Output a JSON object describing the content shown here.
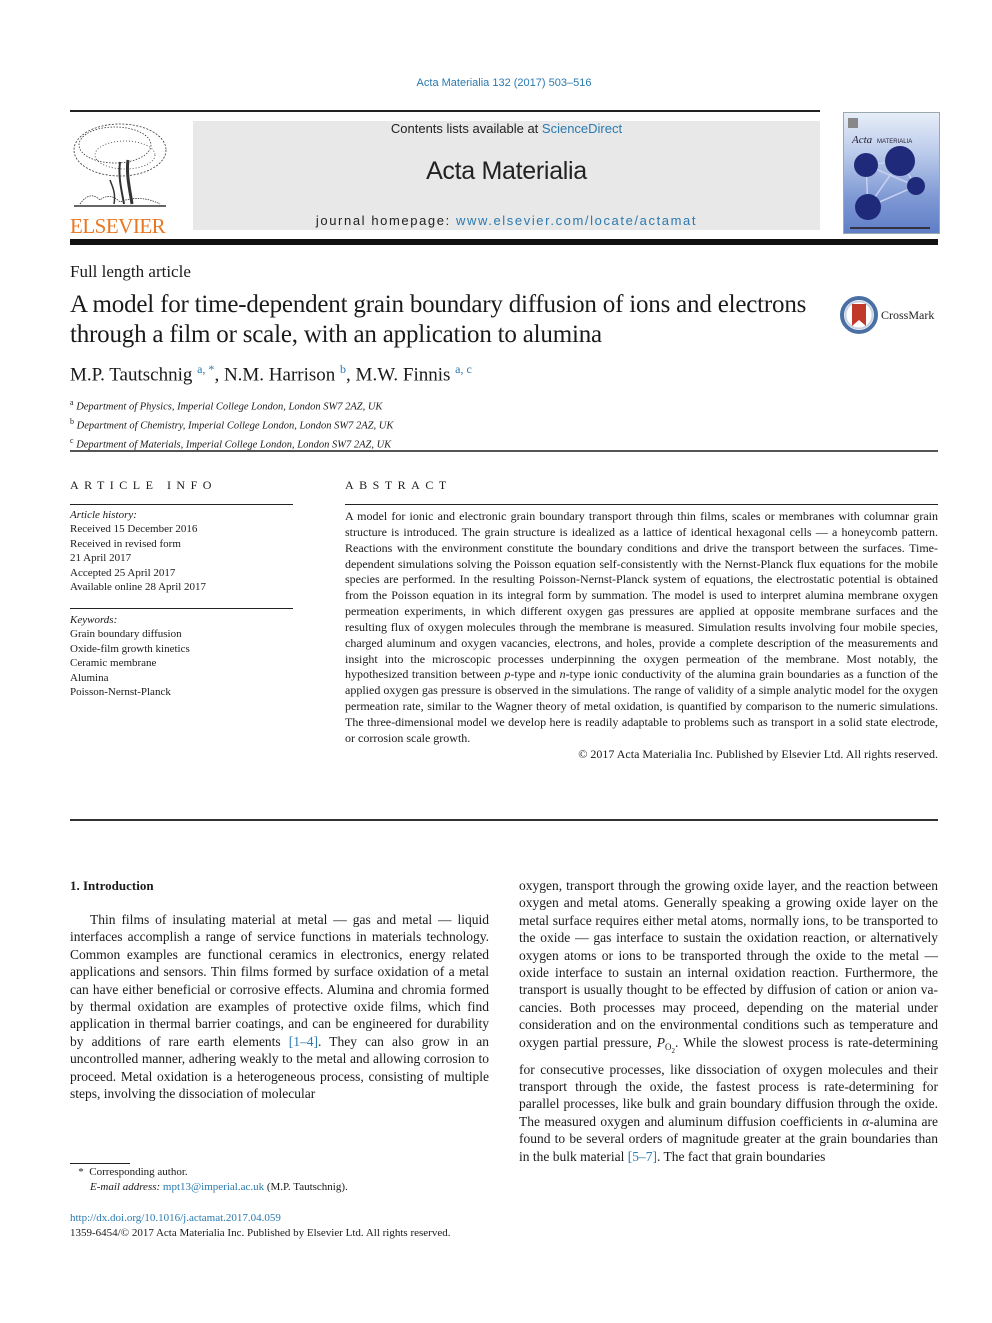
{
  "journal_ref": "Acta Materialia 132 (2017) 503–516",
  "masthead": {
    "contents_prefix": "Contents lists available at ",
    "contents_link": "ScienceDirect",
    "journal_title": "Acta Materialia",
    "homepage_prefix": "journal homepage: ",
    "homepage_link": "www.elsevier.com/locate/actamat"
  },
  "publisher_logo": "ELSEVIER",
  "cover": {
    "title_script": "Acta",
    "title_caps": "MATERIALIA"
  },
  "crossmark_label": "CrossMark",
  "article_type": "Full length article",
  "title": "A model for time-dependent grain boundary diffusion of ions and electrons through a film or scale, with an application to alumina",
  "authors": [
    {
      "name": "M.P. Tautschnig",
      "marks": "a, *"
    },
    {
      "name": "N.M. Harrison",
      "marks": "b"
    },
    {
      "name": "M.W. Finnis",
      "marks": "a, c"
    }
  ],
  "affiliations": [
    {
      "mark": "a",
      "text": "Department of Physics, Imperial College London, London SW7 2AZ, UK"
    },
    {
      "mark": "b",
      "text": "Department of Chemistry, Imperial College London, London SW7 2AZ, UK"
    },
    {
      "mark": "c",
      "text": "Department of Materials, Imperial College London, London SW7 2AZ, UK"
    }
  ],
  "article_info": {
    "heading": "ARTICLE INFO",
    "history_label": "Article history:",
    "history": [
      "Received 15 December 2016",
      "Received in revised form",
      "21 April 2017",
      "Accepted 25 April 2017",
      "Available online 28 April 2017"
    ],
    "keywords_label": "Keywords:",
    "keywords": [
      "Grain boundary diffusion",
      "Oxide-film growth kinetics",
      "Ceramic membrane",
      "Alumina",
      "Poisson-Nernst-Planck"
    ]
  },
  "abstract": {
    "heading": "ABSTRACT",
    "text_1": "A model for ionic and electronic grain boundary transport through thin films, scales or membranes with columnar grain structure is introduced. The grain structure is idealized as a lattice of identical hexagonal cells — a honeycomb pattern. Reactions with the environment constitute the boundary conditions and drive the transport between the surfaces. Time-dependent simulations solving the Poisson equation self-consistently with the Nernst-Planck flux equations for the mobile species are performed. In the resulting Poisson-Nernst-Planck system of equations, the electrostatic potential is obtained from the Poisson equation in its integral form by summation. The model is used to interpret alumina membrane oxygen permeation experiments, in which different oxygen gas pressures are applied at opposite membrane surfaces and the resulting flux of oxygen molecules through the membrane is measured. Simulation results involving four mobile species, charged aluminum and oxygen vacancies, electrons, and holes, provide a complete description of the measurements and insight into the microscopic processes un­dERpinning",
    "p_type": "p",
    "mid_1": "-type and ",
    "n_type": "n",
    "text_2": "-type ionic conductivity of the alumina grain boundaries as a function of the applied oxygen gas pressure is observed in the simulations. The range of validity of a simple analytic model for the oxygen permeation rate, similar to the Wagner theory of metal oxidation, is quantified by comparison to the numeric simulations. The three-dimensional model we develop here is readily adaptable to problems such as transport in a solid state electrode, or corrosion scale growth.",
    "copyright": "© 2017 Acta Materialia Inc. Published by Elsevier Ltd. All rights reserved."
  },
  "introduction": {
    "heading": "1.  Introduction",
    "left_1": "Thin films of insulating material at metal — gas and metal — liquid interfaces accomplish a range of service functions in mate­rials technology. Common examples are functional ceramics in electronics, energy related applications and sensors. Thin films formed by surface oxidation of a metal can have either beneficial or corrosive effects. Alumina and chromia formed by thermal oxida­tion are examples of protective oxide films, which find application in thermal barrier coatings, and can be engineered for durability by additions of rare earth elements ",
    "ref_1": "[1–4]",
    "left_2": ". They can also grow in an uncontrolled manner, adhering weakly to the metal and allowing corrosion to proceed. Metal oxidation is a heterogeneous process, consisting of multiple steps, involving the dissociation of molecular",
    "right_1": "oxygen, transport through the growing oxide layer, and the reaction between oxygen and metal atoms. Generally speaking a growing oxide layer on the metal surface requires either metal atoms, nor­mally ions, to be transported to the oxide — gas interface to sustain the oxidation reaction, or alternatively oxygen atoms or ions to be transported through the oxide to the metal — oxide interface to sustain an internal oxidation reaction. Furthermore, the transport is usually thought to be effected by diffusion of cation or anion va­cancies. Both processes may proceed, depending on the material under consideration and on the environmental conditions such as temperature and oxygen partial pressure, ",
    "p_symbol": "P",
    "p_sub": "O",
    "p_sub2": "2",
    "right_2": ". While the slowest process is rate-determining for consecutive processes, like disso­ciation of oxygen molecules and their transport through the oxide, the fastest process is rate-determining for parallel processes, like bulk and grain boundary diffusion through the oxide. The measured oxygen and aluminum diffusion coefficients in ",
    "alpha": "α",
    "right_3": "-alumina are found to be several orders of magnitude greater at the grain boundaries than in the bulk material ",
    "ref_2": "[5–7]",
    "right_4": ". The fact that grain boundaries"
  },
  "footnote": {
    "star": "*",
    "corresponding": "Corresponding author.",
    "email_label": "E-mail address:",
    "email": "mpt13@imperial.ac.uk",
    "email_owner": " (M.P. Tautschnig)."
  },
  "doi": "http://dx.doi.org/10.1016/j.actamat.2017.04.059",
  "issn_line": "1359-6454/© 2017 Acta Materialia Inc. Published by Elsevier Ltd. All rights reserved."
}
